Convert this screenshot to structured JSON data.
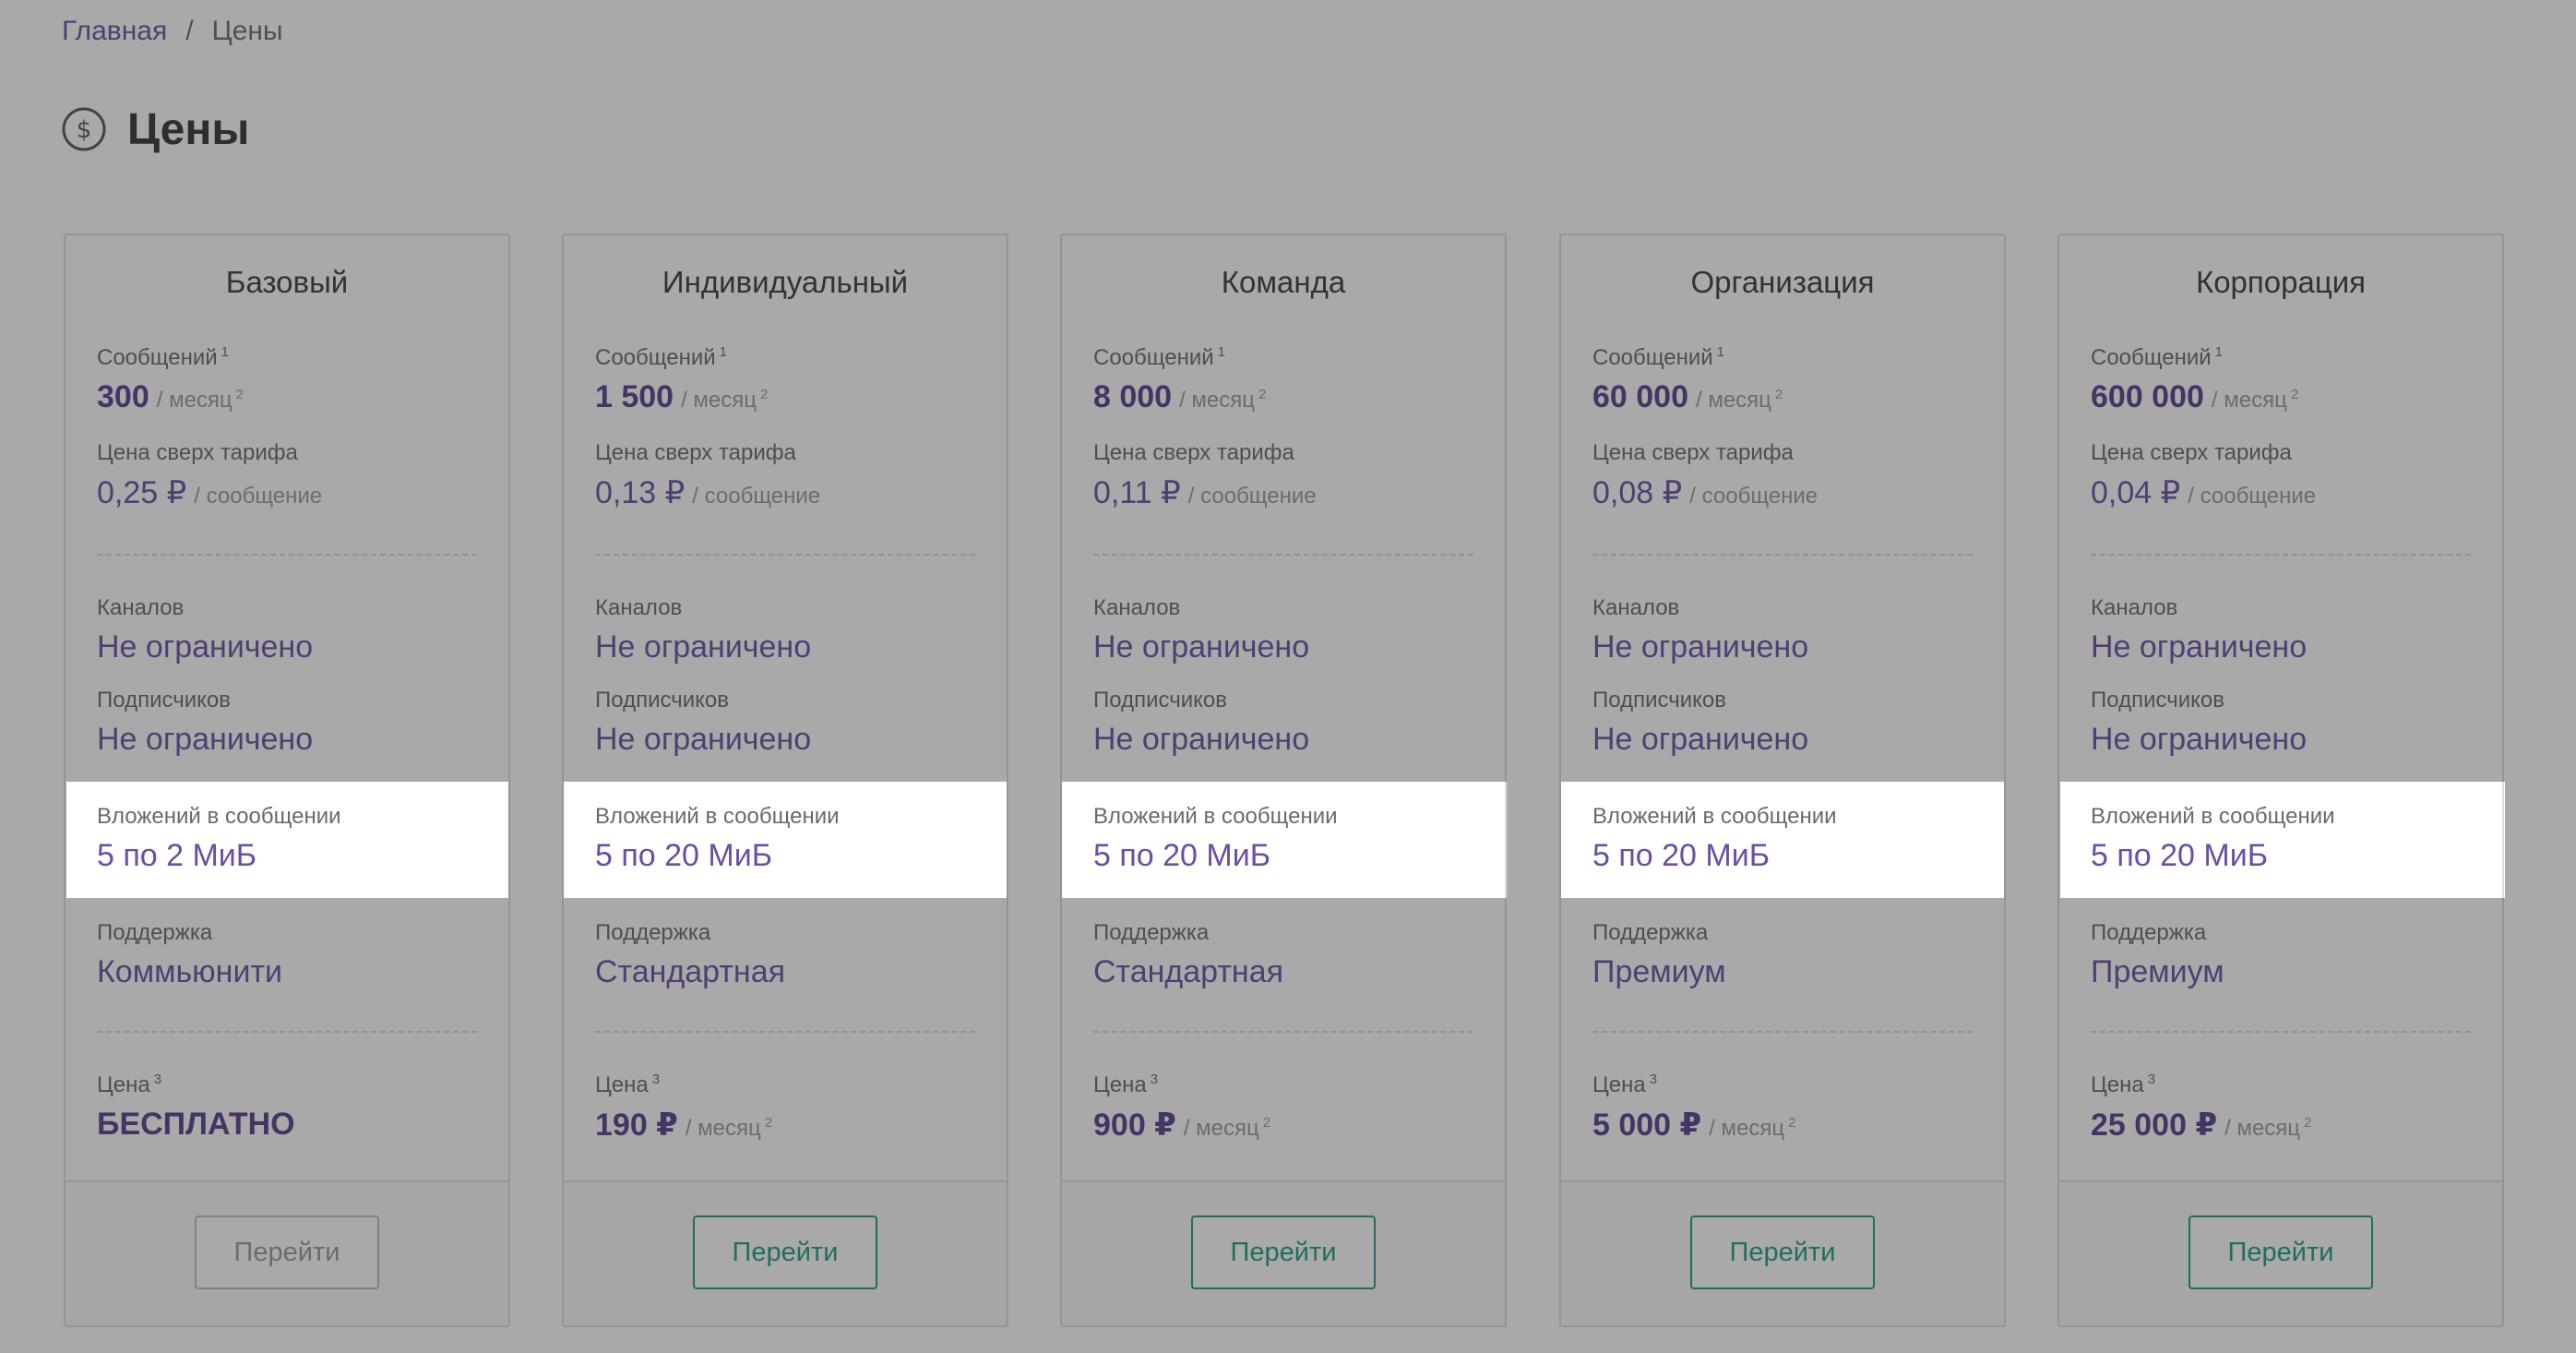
{
  "breadcrumb": {
    "home": "Главная",
    "separator": "/",
    "current": "Цены"
  },
  "page": {
    "title": "Цены",
    "icon": "dollar-circle-icon"
  },
  "labels": {
    "messages": "Сообщений",
    "per_month": "/ месяц",
    "overage": "Цена сверх тарифа",
    "per_message": "/ сообщение",
    "channels": "Каналов",
    "subscribers": "Подписчиков",
    "attachments": "Вложений в сообщении",
    "support": "Поддержка",
    "price": "Цена",
    "go": "Перейти",
    "footnote_1": "1",
    "footnote_2": "2",
    "footnote_3": "3"
  },
  "plans": [
    {
      "name": "Базовый",
      "messages": "300",
      "overage": "0,25 ₽",
      "channels": "Не ограничено",
      "subscribers": "Не ограничено",
      "attachments": "5 по 2 МиБ",
      "support": "Коммьюнити",
      "price": "БЕСПЛАТНО",
      "price_has_period": false,
      "button_disabled": true
    },
    {
      "name": "Индивидуальный",
      "messages": "1 500",
      "overage": "0,13 ₽",
      "channels": "Не ограничено",
      "subscribers": "Не ограничено",
      "attachments": "5 по 20 МиБ",
      "support": "Стандартная",
      "price": "190 ₽",
      "price_has_period": true,
      "button_disabled": false
    },
    {
      "name": "Команда",
      "messages": "8 000",
      "overage": "0,11 ₽",
      "channels": "Не ограничено",
      "subscribers": "Не ограничено",
      "attachments": "5 по 20 МиБ",
      "support": "Стандартная",
      "price": "900 ₽",
      "price_has_period": true,
      "button_disabled": false
    },
    {
      "name": "Организация",
      "messages": "60 000",
      "overage": "0,08 ₽",
      "channels": "Не ограничено",
      "subscribers": "Не ограничено",
      "attachments": "5 по 20 МиБ",
      "support": "Премиум",
      "price": "5 000 ₽",
      "price_has_period": true,
      "button_disabled": false
    },
    {
      "name": "Корпорация",
      "messages": "600 000",
      "overage": "0,04 ₽",
      "channels": "Не ограничено",
      "subscribers": "Не ограничено",
      "attachments": "5 по 20 МиБ",
      "support": "Премиум",
      "price": "25 000 ₽",
      "price_has_period": true,
      "button_disabled": false
    }
  ],
  "colors": {
    "accent": "#6a4fa3",
    "button": "#1f9b84"
  }
}
